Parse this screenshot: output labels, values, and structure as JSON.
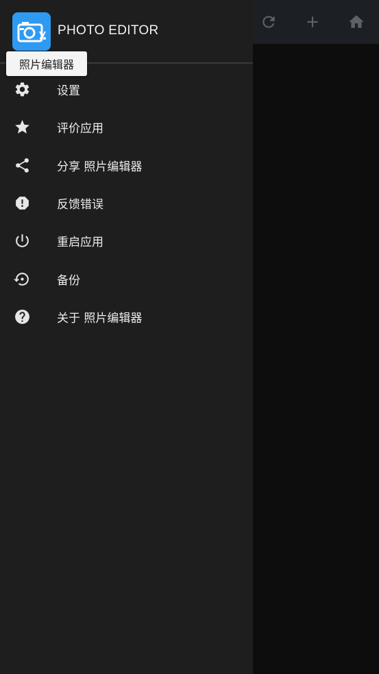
{
  "app": {
    "title": "PHOTO EDITOR",
    "tooltip": "照片编辑器",
    "logo_color": "#2f9af2"
  },
  "toolbar": {
    "icons": [
      "refresh-icon",
      "add-icon",
      "home-icon"
    ],
    "color": "#1c2024"
  },
  "drawer": {
    "background": "#1e1e1e",
    "items": [
      {
        "label": "设置",
        "icon": "gear-icon"
      },
      {
        "label": "评价应用",
        "icon": "star-icon"
      },
      {
        "label": "分享 照片编辑器",
        "icon": "share-icon"
      },
      {
        "label": "反馈错误",
        "icon": "report-icon"
      },
      {
        "label": "重启应用",
        "icon": "power-icon"
      },
      {
        "label": "备份",
        "icon": "restore-icon"
      },
      {
        "label": "关于 照片编辑器",
        "icon": "help-icon"
      }
    ]
  }
}
